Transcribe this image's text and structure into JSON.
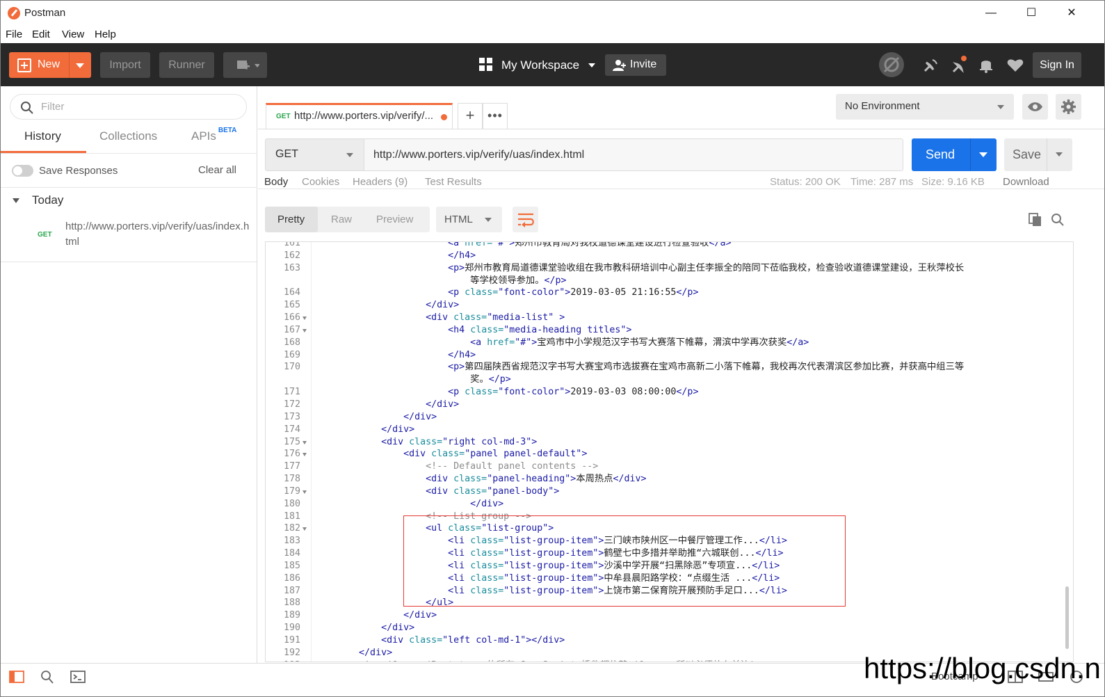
{
  "window": {
    "title": "Postman"
  },
  "menu": [
    "File",
    "Edit",
    "View",
    "Help"
  ],
  "header": {
    "new_label": "New",
    "import_label": "Import",
    "runner_label": "Runner",
    "workspace_label": "My Workspace",
    "invite_label": "Invite",
    "signin_label": "Sign In"
  },
  "sidebar": {
    "filter_placeholder": "Filter",
    "tabs": [
      "History",
      "Collections",
      "APIs"
    ],
    "apis_badge": "BETA",
    "save_responses_label": "Save Responses",
    "clear_all_label": "Clear all",
    "group_label": "Today",
    "history": [
      {
        "method": "GET",
        "url": "http://www.porters.vip/verify/uas/index.html"
      }
    ]
  },
  "request_tab": {
    "method": "GET",
    "title": "http://www.porters.vip/verify/..."
  },
  "environment": {
    "selected": "No Environment"
  },
  "request": {
    "method": "GET",
    "url": "http://www.porters.vip/verify/uas/index.html",
    "send_label": "Send",
    "save_label": "Save"
  },
  "response_tabs": [
    "Body",
    "Cookies",
    "Headers (9)",
    "Test Results"
  ],
  "response_meta": {
    "status": "Status: 200 OK",
    "time": "Time: 287 ms",
    "size": "Size: 9.16 KB",
    "download": "Download"
  },
  "format_buttons": [
    "Pretty",
    "Raw",
    "Preview"
  ],
  "language": "HTML",
  "statusbar": {
    "bootcamp_label": "Bootcamp"
  },
  "watermark": "https://blog.csdn.n",
  "colors": {
    "accent": "#f26b3a",
    "send": "#1a73e8",
    "header_bg": "#282828",
    "highlight": "#e53935"
  }
}
